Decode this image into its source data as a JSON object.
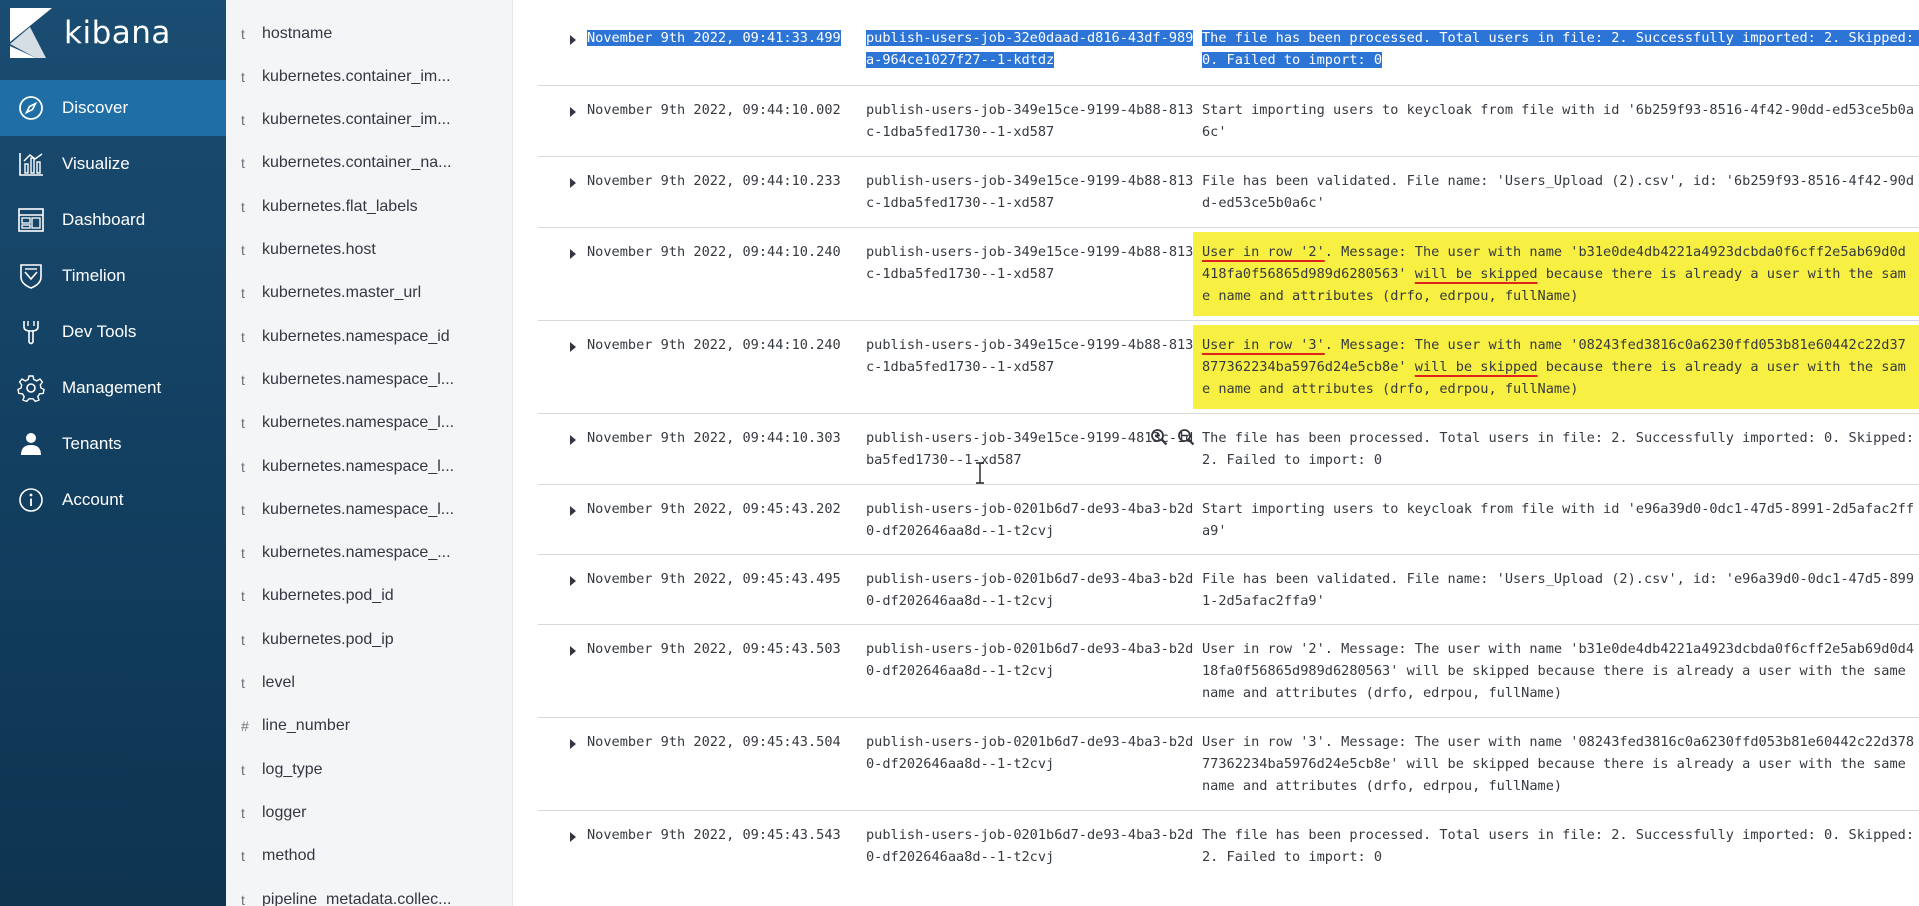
{
  "app": {
    "name": "kibana"
  },
  "nav": {
    "items": [
      {
        "label": "Discover",
        "icon": "compass-icon",
        "active": true
      },
      {
        "label": "Visualize",
        "icon": "bar-chart-icon"
      },
      {
        "label": "Dashboard",
        "icon": "dashboard-icon"
      },
      {
        "label": "Timelion",
        "icon": "shield-icon"
      },
      {
        "label": "Dev Tools",
        "icon": "wrench-icon"
      },
      {
        "label": "Management",
        "icon": "gear-icon"
      },
      {
        "label": "Tenants",
        "icon": "user-icon"
      },
      {
        "label": "Account",
        "icon": "info-icon"
      }
    ]
  },
  "fields": [
    {
      "type": "t",
      "name": "hostname"
    },
    {
      "type": "t",
      "name": "kubernetes.container_im..."
    },
    {
      "type": "t",
      "name": "kubernetes.container_im..."
    },
    {
      "type": "t",
      "name": "kubernetes.container_na..."
    },
    {
      "type": "t",
      "name": "kubernetes.flat_labels"
    },
    {
      "type": "t",
      "name": "kubernetes.host"
    },
    {
      "type": "t",
      "name": "kubernetes.master_url"
    },
    {
      "type": "t",
      "name": "kubernetes.namespace_id"
    },
    {
      "type": "t",
      "name": "kubernetes.namespace_l..."
    },
    {
      "type": "t",
      "name": "kubernetes.namespace_l..."
    },
    {
      "type": "t",
      "name": "kubernetes.namespace_l..."
    },
    {
      "type": "t",
      "name": "kubernetes.namespace_l..."
    },
    {
      "type": "t",
      "name": "kubernetes.namespace_..."
    },
    {
      "type": "t",
      "name": "kubernetes.pod_id"
    },
    {
      "type": "t",
      "name": "kubernetes.pod_ip"
    },
    {
      "type": "t",
      "name": "level"
    },
    {
      "type": "#",
      "name": "line_number"
    },
    {
      "type": "t",
      "name": "log_type"
    },
    {
      "type": "t",
      "name": "logger"
    },
    {
      "type": "t",
      "name": "method"
    },
    {
      "type": "t",
      "name": "pipeline_metadata.collec..."
    }
  ],
  "colors": {
    "nav_bg": "#134466",
    "nav_active": "#1f6fa6",
    "selection": "#2c74d6",
    "highlight_yellow": "#f7ef41",
    "underline_red": "#e0241b"
  },
  "rows": [
    {
      "time": "November 9th 2022, 09:41:33.499",
      "pod": "publish-users-job-32e0daad-d816-43df-989a-964ce1027f27--1-kdtdz",
      "message": "The file has been processed. Total users in file: 2. Successfully imported: 2. Skipped: 0. Failed to import: 0",
      "style": "selected"
    },
    {
      "time": "November 9th 2022, 09:44:10.002",
      "pod": "publish-users-job-349e15ce-9199-4b88-813c-1dba5fed1730--1-xd587",
      "message": "Start importing users to keycloak from file with id '6b259f93-8516-4f42-90dd-ed53ce5b0a6c'"
    },
    {
      "time": "November 9th 2022, 09:44:10.233",
      "pod": "publish-users-job-349e15ce-9199-4b88-813c-1dba5fed1730--1-xd587",
      "message": "File has been validated. File name: 'Users_Upload (2).csv', id: '6b259f93-8516-4f42-90dd-ed53ce5b0a6c'"
    },
    {
      "time": "November 9th 2022, 09:44:10.240",
      "pod": "publish-users-job-349e15ce-9199-4b88-813c-1dba5fed1730--1-xd587",
      "message_parts": [
        {
          "text": "User in row '2'",
          "ul": true
        },
        {
          "text": ". Message: The user with name 'b31e0de4db4221a4923dcbda0f6cff2e5ab69d0d418fa0f56865d989d6280563' "
        },
        {
          "text": "will be skipped",
          "ul": true
        },
        {
          "text": " because there is already a user with the same name and attributes (drfo, edrpou, fullName)"
        }
      ],
      "style": "yellow"
    },
    {
      "time": "November 9th 2022, 09:44:10.240",
      "pod": "publish-users-job-349e15ce-9199-4b88-813c-1dba5fed1730--1-xd587",
      "message_parts": [
        {
          "text": "User in row '3'",
          "ul": true
        },
        {
          "text": ". Message: The user with name '08243fed3816c0a6230ffd053b81e60442c22d37877362234ba5976d24e5cb8e' "
        },
        {
          "text": "will be skipped",
          "ul": true
        },
        {
          "text": " because there is already a user with the same name and attributes (drfo, edrpou, fullName)"
        }
      ],
      "style": "yellow"
    },
    {
      "time": "November 9th 2022, 09:44:10.303",
      "pod": "publish-users-job-349e15ce-9199-4813c-1dba5fed1730--1-xd587",
      "message": "The file has been processed. Total users in file: 2. Successfully imported: 0. Skipped: 2. Failed to import: 0",
      "zoom": true
    },
    {
      "time": "November 9th 2022, 09:45:43.202",
      "pod": "publish-users-job-0201b6d7-de93-4ba3-b2d0-df202646aa8d--1-t2cvj",
      "message": "Start importing users to keycloak from file with id 'e96a39d0-0dc1-47d5-8991-2d5afac2ffa9'"
    },
    {
      "time": "November 9th 2022, 09:45:43.495",
      "pod": "publish-users-job-0201b6d7-de93-4ba3-b2d0-df202646aa8d--1-t2cvj",
      "message": "File has been validated. File name: 'Users_Upload (2).csv', id: 'e96a39d0-0dc1-47d5-8991-2d5afac2ffa9'"
    },
    {
      "time": "November 9th 2022, 09:45:43.503",
      "pod": "publish-users-job-0201b6d7-de93-4ba3-b2d0-df202646aa8d--1-t2cvj",
      "message": "User in row '2'. Message: The user with name 'b31e0de4db4221a4923dcbda0f6cff2e5ab69d0d418fa0f56865d989d6280563' will be skipped because there is already a user with the same name and attributes (drfo, edrpou, fullName)"
    },
    {
      "time": "November 9th 2022, 09:45:43.504",
      "pod": "publish-users-job-0201b6d7-de93-4ba3-b2d0-df202646aa8d--1-t2cvj",
      "message": "User in row '3'. Message: The user with name '08243fed3816c0a6230ffd053b81e60442c22d37877362234ba5976d24e5cb8e' will be skipped because there is already a user with the same name and attributes (drfo, edrpou, fullName)"
    },
    {
      "time": "November 9th 2022, 09:45:43.543",
      "pod": "publish-users-job-0201b6d7-de93-4ba3-b2d0-df202646aa8d--1-t2cvj",
      "message": "The file has been processed. Total users in file: 2. Successfully imported: 0. Skipped: 2. Failed to import: 0"
    }
  ]
}
